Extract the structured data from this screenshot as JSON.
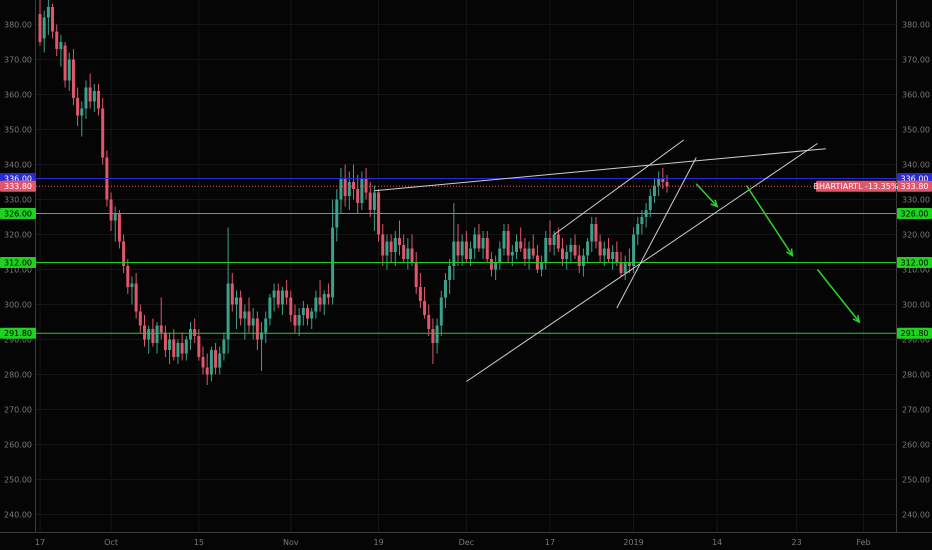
{
  "chart_data": {
    "type": "candlestick",
    "symbol_label": "BHARTIARTL -13.35%",
    "ylim": [
      235,
      387
    ],
    "y_ticks": [
      {
        "v": 380,
        "label": "380.00"
      },
      {
        "v": 370,
        "label": "370.00"
      },
      {
        "v": 360,
        "label": "360.00"
      },
      {
        "v": 350,
        "label": "350.00"
      },
      {
        "v": 340,
        "label": "340.00"
      },
      {
        "v": 330,
        "label": "330.00"
      },
      {
        "v": 320,
        "label": "320.00"
      },
      {
        "v": 310,
        "label": "310.00"
      },
      {
        "v": 300,
        "label": "300.00"
      },
      {
        "v": 290,
        "label": "290.00"
      },
      {
        "v": 280,
        "label": "280.00"
      },
      {
        "v": 270,
        "label": "270.00"
      },
      {
        "v": 260,
        "label": "260.00"
      },
      {
        "v": 250,
        "label": "250.00"
      },
      {
        "v": 240,
        "label": "240.00"
      }
    ],
    "x_ticks": [
      {
        "i": 0,
        "label": "17"
      },
      {
        "i": 17,
        "label": "Oct"
      },
      {
        "i": 38,
        "label": "15"
      },
      {
        "i": 60,
        "label": "Nov"
      },
      {
        "i": 81,
        "label": "19"
      },
      {
        "i": 102,
        "label": "Dec"
      },
      {
        "i": 122,
        "label": "17"
      },
      {
        "i": 142,
        "label": "2019"
      },
      {
        "i": 162,
        "label": "14"
      },
      {
        "i": 181,
        "label": "23"
      },
      {
        "i": 197,
        "label": "Feb"
      }
    ],
    "levels": [
      {
        "value": 336.0,
        "label": "336.00",
        "kind": "blue"
      },
      {
        "value": 326.0,
        "label": "326.00",
        "kind": "green"
      },
      {
        "value": 312.0,
        "label": "312.00",
        "kind": "green"
      },
      {
        "value": 291.8,
        "label": "291.80",
        "kind": "green"
      }
    ],
    "last_price": {
      "value": 333.8,
      "label": "333.80"
    },
    "colors": {
      "up": "#3aa18b",
      "down": "#e0566b",
      "blue": "#2a2ad6",
      "green": "#1fd21f",
      "last": "#e0566b"
    },
    "ohlc": [
      {
        "i": 0,
        "o": 383,
        "h": 388,
        "l": 374,
        "c": 375
      },
      {
        "i": 1,
        "o": 376,
        "h": 384,
        "l": 372,
        "c": 382
      },
      {
        "i": 2,
        "o": 382,
        "h": 387,
        "l": 377,
        "c": 385
      },
      {
        "i": 3,
        "o": 385,
        "h": 386,
        "l": 376,
        "c": 378
      },
      {
        "i": 4,
        "o": 378,
        "h": 380,
        "l": 371,
        "c": 373
      },
      {
        "i": 5,
        "o": 373,
        "h": 377,
        "l": 368,
        "c": 375
      },
      {
        "i": 6,
        "o": 374,
        "h": 375,
        "l": 362,
        "c": 364
      },
      {
        "i": 7,
        "o": 364,
        "h": 372,
        "l": 361,
        "c": 370
      },
      {
        "i": 8,
        "o": 370,
        "h": 373,
        "l": 357,
        "c": 359
      },
      {
        "i": 9,
        "o": 359,
        "h": 362,
        "l": 351,
        "c": 354
      },
      {
        "i": 10,
        "o": 354,
        "h": 358,
        "l": 348,
        "c": 356
      },
      {
        "i": 11,
        "o": 356,
        "h": 364,
        "l": 353,
        "c": 362
      },
      {
        "i": 12,
        "o": 362,
        "h": 366,
        "l": 356,
        "c": 358
      },
      {
        "i": 13,
        "o": 358,
        "h": 363,
        "l": 355,
        "c": 361
      },
      {
        "i": 14,
        "o": 361,
        "h": 363,
        "l": 354,
        "c": 356
      },
      {
        "i": 15,
        "o": 356,
        "h": 359,
        "l": 340,
        "c": 342
      },
      {
        "i": 16,
        "o": 342,
        "h": 344,
        "l": 328,
        "c": 330
      },
      {
        "i": 17,
        "o": 330,
        "h": 332,
        "l": 321,
        "c": 324
      },
      {
        "i": 18,
        "o": 324,
        "h": 328,
        "l": 318,
        "c": 326
      },
      {
        "i": 19,
        "o": 326,
        "h": 327,
        "l": 316,
        "c": 318
      },
      {
        "i": 20,
        "o": 318,
        "h": 320,
        "l": 309,
        "c": 311
      },
      {
        "i": 21,
        "o": 311,
        "h": 313,
        "l": 303,
        "c": 305
      },
      {
        "i": 22,
        "o": 305,
        "h": 308,
        "l": 300,
        "c": 306
      },
      {
        "i": 23,
        "o": 306,
        "h": 309,
        "l": 296,
        "c": 298
      },
      {
        "i": 24,
        "o": 298,
        "h": 300,
        "l": 292,
        "c": 294
      },
      {
        "i": 25,
        "o": 294,
        "h": 297,
        "l": 288,
        "c": 290
      },
      {
        "i": 26,
        "o": 290,
        "h": 294,
        "l": 286,
        "c": 293
      },
      {
        "i": 27,
        "o": 293,
        "h": 296,
        "l": 288,
        "c": 289
      },
      {
        "i": 28,
        "o": 289,
        "h": 295,
        "l": 286,
        "c": 294
      },
      {
        "i": 29,
        "o": 294,
        "h": 302,
        "l": 290,
        "c": 292
      },
      {
        "i": 30,
        "o": 292,
        "h": 294,
        "l": 285,
        "c": 287
      },
      {
        "i": 31,
        "o": 287,
        "h": 292,
        "l": 283,
        "c": 290
      },
      {
        "i": 32,
        "o": 290,
        "h": 293,
        "l": 284,
        "c": 285
      },
      {
        "i": 33,
        "o": 285,
        "h": 290,
        "l": 283,
        "c": 289
      },
      {
        "i": 34,
        "o": 289,
        "h": 292,
        "l": 284,
        "c": 286
      },
      {
        "i": 35,
        "o": 286,
        "h": 291,
        "l": 284,
        "c": 290
      },
      {
        "i": 36,
        "o": 290,
        "h": 295,
        "l": 287,
        "c": 293
      },
      {
        "i": 37,
        "o": 293,
        "h": 296,
        "l": 289,
        "c": 291
      },
      {
        "i": 38,
        "o": 291,
        "h": 293,
        "l": 284,
        "c": 285
      },
      {
        "i": 39,
        "o": 285,
        "h": 288,
        "l": 280,
        "c": 282
      },
      {
        "i": 40,
        "o": 282,
        "h": 286,
        "l": 277,
        "c": 280
      },
      {
        "i": 41,
        "o": 280,
        "h": 288,
        "l": 278,
        "c": 287
      },
      {
        "i": 42,
        "o": 287,
        "h": 289,
        "l": 280,
        "c": 282
      },
      {
        "i": 43,
        "o": 282,
        "h": 288,
        "l": 280,
        "c": 286
      },
      {
        "i": 44,
        "o": 286,
        "h": 292,
        "l": 284,
        "c": 290
      },
      {
        "i": 45,
        "o": 290,
        "h": 322,
        "l": 286,
        "c": 306
      },
      {
        "i": 46,
        "o": 306,
        "h": 309,
        "l": 298,
        "c": 300
      },
      {
        "i": 47,
        "o": 300,
        "h": 304,
        "l": 293,
        "c": 302
      },
      {
        "i": 48,
        "o": 302,
        "h": 304,
        "l": 294,
        "c": 296
      },
      {
        "i": 49,
        "o": 296,
        "h": 300,
        "l": 290,
        "c": 298
      },
      {
        "i": 50,
        "o": 298,
        "h": 302,
        "l": 292,
        "c": 294
      },
      {
        "i": 51,
        "o": 294,
        "h": 299,
        "l": 290,
        "c": 296
      },
      {
        "i": 52,
        "o": 296,
        "h": 298,
        "l": 287,
        "c": 290
      },
      {
        "i": 53,
        "o": 290,
        "h": 295,
        "l": 281,
        "c": 292
      },
      {
        "i": 54,
        "o": 292,
        "h": 298,
        "l": 289,
        "c": 296
      },
      {
        "i": 55,
        "o": 296,
        "h": 303,
        "l": 294,
        "c": 302
      },
      {
        "i": 56,
        "o": 302,
        "h": 306,
        "l": 298,
        "c": 304
      },
      {
        "i": 57,
        "o": 304,
        "h": 306,
        "l": 299,
        "c": 300
      },
      {
        "i": 58,
        "o": 300,
        "h": 305,
        "l": 297,
        "c": 304
      },
      {
        "i": 59,
        "o": 304,
        "h": 307,
        "l": 300,
        "c": 302
      },
      {
        "i": 60,
        "o": 302,
        "h": 304,
        "l": 295,
        "c": 297
      },
      {
        "i": 61,
        "o": 297,
        "h": 300,
        "l": 292,
        "c": 294
      },
      {
        "i": 62,
        "o": 294,
        "h": 299,
        "l": 291,
        "c": 297
      },
      {
        "i": 63,
        "o": 297,
        "h": 301,
        "l": 294,
        "c": 299
      },
      {
        "i": 64,
        "o": 299,
        "h": 300,
        "l": 294,
        "c": 296
      },
      {
        "i": 65,
        "o": 296,
        "h": 299,
        "l": 293,
        "c": 298
      },
      {
        "i": 66,
        "o": 298,
        "h": 304,
        "l": 296,
        "c": 302
      },
      {
        "i": 67,
        "o": 302,
        "h": 307,
        "l": 298,
        "c": 300
      },
      {
        "i": 68,
        "o": 300,
        "h": 304,
        "l": 297,
        "c": 303
      },
      {
        "i": 69,
        "o": 303,
        "h": 306,
        "l": 300,
        "c": 302
      },
      {
        "i": 70,
        "o": 302,
        "h": 330,
        "l": 300,
        "c": 322
      },
      {
        "i": 71,
        "o": 322,
        "h": 333,
        "l": 318,
        "c": 330
      },
      {
        "i": 72,
        "o": 330,
        "h": 339,
        "l": 326,
        "c": 336
      },
      {
        "i": 73,
        "o": 336,
        "h": 340,
        "l": 328,
        "c": 331
      },
      {
        "i": 74,
        "o": 331,
        "h": 338,
        "l": 327,
        "c": 335
      },
      {
        "i": 75,
        "o": 335,
        "h": 340,
        "l": 330,
        "c": 333
      },
      {
        "i": 76,
        "o": 333,
        "h": 337,
        "l": 326,
        "c": 329
      },
      {
        "i": 77,
        "o": 329,
        "h": 338,
        "l": 327,
        "c": 336
      },
      {
        "i": 78,
        "o": 336,
        "h": 339,
        "l": 330,
        "c": 332
      },
      {
        "i": 79,
        "o": 332,
        "h": 335,
        "l": 325,
        "c": 327
      },
      {
        "i": 80,
        "o": 327,
        "h": 334,
        "l": 321,
        "c": 332
      },
      {
        "i": 81,
        "o": 332,
        "h": 333,
        "l": 318,
        "c": 320
      },
      {
        "i": 82,
        "o": 320,
        "h": 323,
        "l": 311,
        "c": 314
      },
      {
        "i": 83,
        "o": 314,
        "h": 320,
        "l": 310,
        "c": 318
      },
      {
        "i": 84,
        "o": 318,
        "h": 320,
        "l": 312,
        "c": 315
      },
      {
        "i": 85,
        "o": 315,
        "h": 321,
        "l": 311,
        "c": 319
      },
      {
        "i": 86,
        "o": 319,
        "h": 324,
        "l": 314,
        "c": 317
      },
      {
        "i": 87,
        "o": 317,
        "h": 320,
        "l": 312,
        "c": 313
      },
      {
        "i": 88,
        "o": 313,
        "h": 319,
        "l": 310,
        "c": 316
      },
      {
        "i": 89,
        "o": 316,
        "h": 320,
        "l": 311,
        "c": 312
      },
      {
        "i": 90,
        "o": 312,
        "h": 315,
        "l": 303,
        "c": 305
      },
      {
        "i": 91,
        "o": 305,
        "h": 309,
        "l": 299,
        "c": 301
      },
      {
        "i": 92,
        "o": 301,
        "h": 305,
        "l": 296,
        "c": 297
      },
      {
        "i": 93,
        "o": 297,
        "h": 300,
        "l": 291,
        "c": 293
      },
      {
        "i": 94,
        "o": 293,
        "h": 296,
        "l": 283,
        "c": 289
      },
      {
        "i": 95,
        "o": 289,
        "h": 296,
        "l": 286,
        "c": 294
      },
      {
        "i": 96,
        "o": 294,
        "h": 304,
        "l": 291,
        "c": 302
      },
      {
        "i": 97,
        "o": 302,
        "h": 309,
        "l": 299,
        "c": 307
      },
      {
        "i": 98,
        "o": 307,
        "h": 313,
        "l": 303,
        "c": 311
      },
      {
        "i": 99,
        "o": 311,
        "h": 329,
        "l": 307,
        "c": 318
      },
      {
        "i": 100,
        "o": 318,
        "h": 323,
        "l": 311,
        "c": 314
      },
      {
        "i": 101,
        "o": 314,
        "h": 320,
        "l": 311,
        "c": 318
      },
      {
        "i": 102,
        "o": 318,
        "h": 321,
        "l": 312,
        "c": 313
      },
      {
        "i": 103,
        "o": 313,
        "h": 318,
        "l": 311,
        "c": 316
      },
      {
        "i": 104,
        "o": 316,
        "h": 322,
        "l": 313,
        "c": 320
      },
      {
        "i": 105,
        "o": 320,
        "h": 323,
        "l": 315,
        "c": 316
      },
      {
        "i": 106,
        "o": 316,
        "h": 321,
        "l": 313,
        "c": 319
      },
      {
        "i": 107,
        "o": 319,
        "h": 321,
        "l": 312,
        "c": 313
      },
      {
        "i": 108,
        "o": 313,
        "h": 315,
        "l": 308,
        "c": 310
      },
      {
        "i": 109,
        "o": 310,
        "h": 314,
        "l": 307,
        "c": 312
      },
      {
        "i": 110,
        "o": 312,
        "h": 318,
        "l": 310,
        "c": 316
      },
      {
        "i": 111,
        "o": 316,
        "h": 323,
        "l": 314,
        "c": 321
      },
      {
        "i": 112,
        "o": 321,
        "h": 323,
        "l": 312,
        "c": 314
      },
      {
        "i": 113,
        "o": 314,
        "h": 317,
        "l": 311,
        "c": 315
      },
      {
        "i": 114,
        "o": 315,
        "h": 320,
        "l": 313,
        "c": 318
      },
      {
        "i": 115,
        "o": 318,
        "h": 322,
        "l": 315,
        "c": 316
      },
      {
        "i": 116,
        "o": 316,
        "h": 319,
        "l": 311,
        "c": 313
      },
      {
        "i": 117,
        "o": 313,
        "h": 318,
        "l": 310,
        "c": 316
      },
      {
        "i": 118,
        "o": 316,
        "h": 320,
        "l": 313,
        "c": 314
      },
      {
        "i": 119,
        "o": 314,
        "h": 317,
        "l": 309,
        "c": 310
      },
      {
        "i": 120,
        "o": 310,
        "h": 314,
        "l": 308,
        "c": 312
      },
      {
        "i": 121,
        "o": 312,
        "h": 321,
        "l": 310,
        "c": 319
      },
      {
        "i": 122,
        "o": 319,
        "h": 324,
        "l": 315,
        "c": 317
      },
      {
        "i": 123,
        "o": 317,
        "h": 321,
        "l": 314,
        "c": 320
      },
      {
        "i": 124,
        "o": 320,
        "h": 322,
        "l": 315,
        "c": 316
      },
      {
        "i": 125,
        "o": 316,
        "h": 319,
        "l": 311,
        "c": 313
      },
      {
        "i": 126,
        "o": 313,
        "h": 317,
        "l": 310,
        "c": 315
      },
      {
        "i": 127,
        "o": 315,
        "h": 319,
        "l": 312,
        "c": 317
      },
      {
        "i": 128,
        "o": 317,
        "h": 320,
        "l": 313,
        "c": 314
      },
      {
        "i": 129,
        "o": 314,
        "h": 317,
        "l": 309,
        "c": 311
      },
      {
        "i": 130,
        "o": 311,
        "h": 316,
        "l": 308,
        "c": 314
      },
      {
        "i": 131,
        "o": 314,
        "h": 319,
        "l": 312,
        "c": 318
      },
      {
        "i": 132,
        "o": 318,
        "h": 325,
        "l": 315,
        "c": 323
      },
      {
        "i": 133,
        "o": 323,
        "h": 325,
        "l": 316,
        "c": 318
      },
      {
        "i": 134,
        "o": 318,
        "h": 320,
        "l": 312,
        "c": 314
      },
      {
        "i": 135,
        "o": 314,
        "h": 318,
        "l": 311,
        "c": 316
      },
      {
        "i": 136,
        "o": 316,
        "h": 319,
        "l": 312,
        "c": 313
      },
      {
        "i": 137,
        "o": 313,
        "h": 317,
        "l": 310,
        "c": 315
      },
      {
        "i": 138,
        "o": 315,
        "h": 318,
        "l": 311,
        "c": 312
      },
      {
        "i": 139,
        "o": 312,
        "h": 315,
        "l": 308,
        "c": 309
      },
      {
        "i": 140,
        "o": 309,
        "h": 314,
        "l": 307,
        "c": 312
      },
      {
        "i": 141,
        "o": 312,
        "h": 316,
        "l": 309,
        "c": 311
      },
      {
        "i": 142,
        "o": 311,
        "h": 322,
        "l": 309,
        "c": 320
      },
      {
        "i": 143,
        "o": 320,
        "h": 325,
        "l": 317,
        "c": 323
      },
      {
        "i": 144,
        "o": 323,
        "h": 327,
        "l": 320,
        "c": 325
      },
      {
        "i": 145,
        "o": 325,
        "h": 329,
        "l": 322,
        "c": 327
      },
      {
        "i": 146,
        "o": 327,
        "h": 333,
        "l": 325,
        "c": 331
      },
      {
        "i": 147,
        "o": 331,
        "h": 336,
        "l": 329,
        "c": 334
      },
      {
        "i": 148,
        "o": 334,
        "h": 338,
        "l": 331,
        "c": 336
      },
      {
        "i": 149,
        "o": 336,
        "h": 339,
        "l": 333,
        "c": 335
      },
      {
        "i": 150,
        "o": 335,
        "h": 337,
        "l": 332,
        "c": 333.8
      }
    ],
    "trendlines": [
      {
        "i1": 80,
        "v1": 332.5,
        "i2": 188,
        "v2": 344.5,
        "color": "#cfcfcf"
      },
      {
        "i1": 102,
        "v1": 278,
        "i2": 186,
        "v2": 346,
        "color": "#cfcfcf"
      },
      {
        "i1": 123,
        "v1": 320,
        "i2": 154,
        "v2": 347,
        "color": "#cfcfcf"
      },
      {
        "i1": 138,
        "v1": 299,
        "i2": 157,
        "v2": 342,
        "color": "#cfcfcf"
      }
    ],
    "arrows": [
      {
        "i1": 157,
        "v1": 334.5,
        "i2": 162,
        "v2": 328
      },
      {
        "i1": 169,
        "v1": 334,
        "i2": 180,
        "v2": 314
      },
      {
        "i1": 186,
        "v1": 310,
        "i2": 196,
        "v2": 295
      }
    ]
  }
}
